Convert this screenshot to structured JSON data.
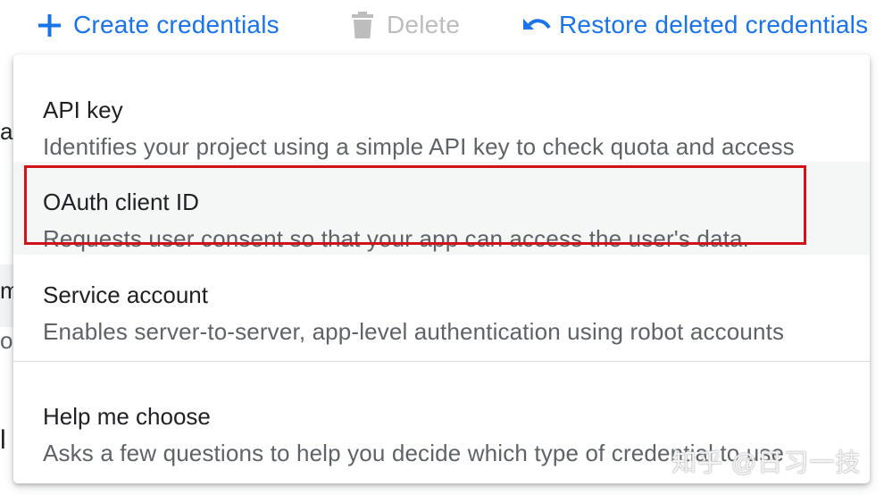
{
  "toolbar": {
    "create_label": "Create credentials",
    "delete_label": "Delete",
    "restore_label": "Restore deleted credentials"
  },
  "background": {
    "fragments": [
      "a",
      "m",
      "o",
      "l"
    ]
  },
  "menu": {
    "items": [
      {
        "title": "API key",
        "description": "Identifies your project using a simple API key to check quota and access"
      },
      {
        "title": "OAuth client ID",
        "description": "Requests user consent so that your app can access the user's data."
      },
      {
        "title": "Service account",
        "description": "Enables server-to-server, app-level authentication using robot accounts"
      },
      {
        "title": "Help me choose",
        "description": "Asks a few questions to help you decide which type of credential to use"
      }
    ]
  },
  "watermark": "知乎 @日习一技",
  "colors": {
    "accent": "#1a73e8",
    "disabled": "#bdbdbd",
    "highlight_border": "#d0121b"
  }
}
